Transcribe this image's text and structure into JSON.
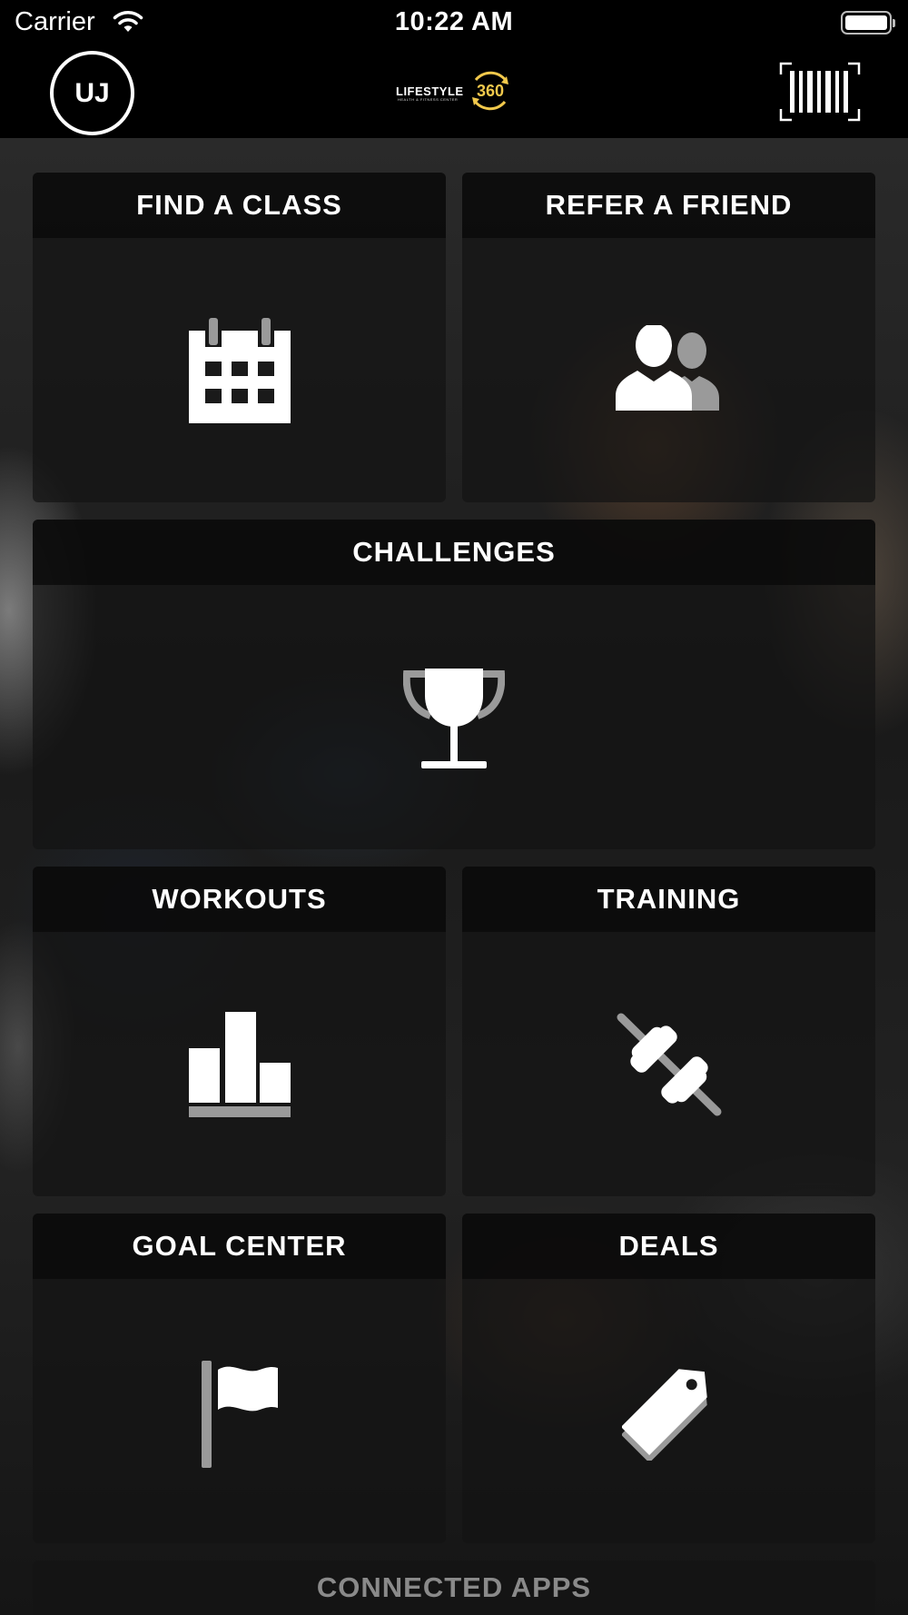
{
  "status_bar": {
    "carrier": "Carrier",
    "time": "10:22 AM"
  },
  "nav": {
    "avatar_initials": "UJ",
    "logo_text": "LIFESTYLE",
    "logo_subtext": "HEALTH & FITNESS CENTER",
    "logo_number": "360",
    "barcode_icon": "barcode-icon"
  },
  "tiles": [
    {
      "label": "FIND A CLASS",
      "icon": "calendar-icon"
    },
    {
      "label": "REFER A FRIEND",
      "icon": "people-icon"
    },
    {
      "label": "CHALLENGES",
      "icon": "trophy-icon"
    },
    {
      "label": "WORKOUTS",
      "icon": "bar-chart-icon"
    },
    {
      "label": "TRAINING",
      "icon": "dumbbell-icon"
    },
    {
      "label": "GOAL CENTER",
      "icon": "flag-icon"
    },
    {
      "label": "DEALS",
      "icon": "tag-icon"
    },
    {
      "label": "CONNECTED APPS",
      "icon": ""
    }
  ],
  "colors": {
    "background": "#000000",
    "tile_bg": "#141414",
    "logo_accent": "#f2c94c",
    "icon_secondary": "#9a9a9a"
  }
}
